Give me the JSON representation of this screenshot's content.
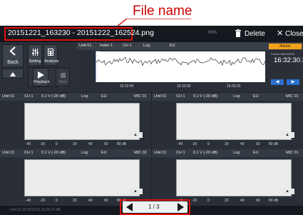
{
  "annotation": {
    "label": "File name"
  },
  "titlebar": {
    "file_name": "20151221_163230 - 20151222_162524.png",
    "file_sub": "2015/12/21 16:32:30",
    "battery": "93%",
    "delete_label": "Delete",
    "close_label": "Close"
  },
  "controls": {
    "back": "Back",
    "setting": "Setting",
    "analysis": "Analysis",
    "playback": "Playback",
    "stop": "Stop"
  },
  "trend": {
    "unit": "Unit 01",
    "index": "Index 1",
    "channel": "CH 1",
    "scale": "Log",
    "eu": "EU",
    "y_ticks": [
      "80",
      "40",
      "0"
    ],
    "x_ticks": [
      "16:32:40",
      "16:33:00",
      "16:33:20"
    ],
    "marker_label": "Marker",
    "marker_small": "Cursor  16/12/2015",
    "marker_time": "16:32:30.3"
  },
  "panels": [
    {
      "unit": "Unit 01",
      "channel": "CH 1",
      "range": "0.1 V (-20 dB)",
      "scale": "Log",
      "eu": "EU",
      "mic": "MIC 01"
    },
    {
      "unit": "Unit 01",
      "channel": "CH 1",
      "range": "0.1 V (-20 dB)",
      "scale": "Log",
      "eu": "EU",
      "mic": "MIC 01"
    },
    {
      "unit": "Unit 01",
      "channel": "CH 1",
      "range": "0.1 V (-20 dB)",
      "scale": "Log",
      "eu": "EU",
      "mic": "MIC 02"
    },
    {
      "unit": "Unit 01",
      "channel": "CH 1",
      "range": "0.1 V (-20 dB)",
      "scale": "Log",
      "eu": "EU",
      "mic": "MIC 01"
    }
  ],
  "x_axis_ticks": [
    "-40",
    "-20",
    "0",
    "20",
    "40",
    "60",
    "80 dB"
  ],
  "footer": {
    "text": "Unit 01  2015/12/22 16:25:24 dB"
  },
  "pager": {
    "text": "1 / 3"
  },
  "colors": {
    "accent": "#e01010",
    "marker": "#f2a21a",
    "nav": "#2b6fcc"
  }
}
